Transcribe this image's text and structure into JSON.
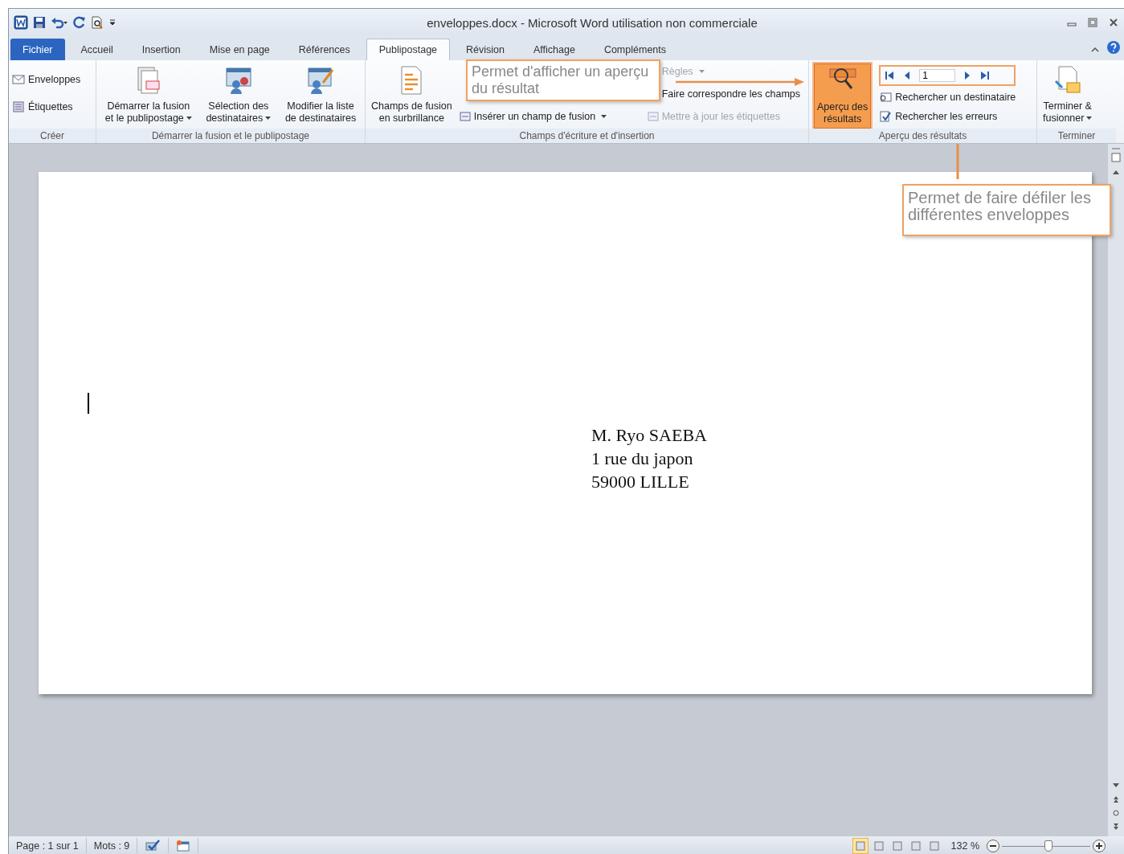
{
  "window": {
    "title": "enveloppes.docx - Microsoft Word utilisation non commerciale"
  },
  "tabs": [
    {
      "label": "Fichier",
      "kind": "file",
      "selected": false
    },
    {
      "label": "Accueil",
      "kind": "tab",
      "selected": false
    },
    {
      "label": "Insertion",
      "kind": "tab",
      "selected": false
    },
    {
      "label": "Mise en page",
      "kind": "tab",
      "selected": false
    },
    {
      "label": "Références",
      "kind": "tab",
      "selected": false
    },
    {
      "label": "Publipostage",
      "kind": "tab",
      "selected": true
    },
    {
      "label": "Révision",
      "kind": "tab",
      "selected": false
    },
    {
      "label": "Affichage",
      "kind": "tab",
      "selected": false
    },
    {
      "label": "Compléments",
      "kind": "tab",
      "selected": false
    }
  ],
  "ribbon": {
    "groups": [
      {
        "label": "Créer",
        "items": [
          {
            "kind": "small",
            "label": "Enveloppes",
            "disabled": false
          },
          {
            "kind": "small",
            "label": "Étiquettes",
            "disabled": false
          }
        ]
      },
      {
        "label": "Démarrer la fusion et le publipostage",
        "items": [
          {
            "kind": "large",
            "lines": [
              "Démarrer la fusion",
              "et le publipostage"
            ],
            "dropdown": true,
            "selected": false
          },
          {
            "kind": "large",
            "lines": [
              "Sélection des",
              "destinataires"
            ],
            "dropdown": true,
            "selected": false
          },
          {
            "kind": "large",
            "lines": [
              "Modifier la liste",
              "de destinataires"
            ],
            "selected": false
          }
        ]
      },
      {
        "label": "Champs d'écriture et d'insertion",
        "items": [
          {
            "kind": "large",
            "lines": [
              "Champs de fusion",
              "en surbrillance"
            ],
            "selected": false
          },
          {
            "kind": "column",
            "items": [
              {
                "label": "Insérer un champ de fusion",
                "dropdown": true,
                "disabled": false
              }
            ]
          },
          {
            "kind": "column",
            "items": [
              {
                "label": "Règles",
                "dropdown": true,
                "disabled": true
              },
              {
                "label": "Faire correspondre les champs",
                "disabled": false
              },
              {
                "label": "Mettre à jour les étiquettes",
                "disabled": true
              }
            ]
          }
        ]
      },
      {
        "label": "Aperçu des résultats",
        "items": [
          {
            "kind": "large",
            "lines": [
              "Aperçu des",
              "résultats"
            ],
            "selected": true
          },
          {
            "kind": "nav",
            "record": "1",
            "items": [
              {
                "label": "Rechercher un destinataire",
                "disabled": false
              },
              {
                "label": "Rechercher les erreurs",
                "disabled": false
              }
            ]
          }
        ]
      },
      {
        "label": "Terminer",
        "items": [
          {
            "kind": "large",
            "lines": [
              "Terminer &",
              "fusionner"
            ],
            "dropdown": true,
            "selected": false
          }
        ]
      }
    ]
  },
  "callouts": [
    {
      "text": "Permet d'afficher un aperçu du résultat"
    },
    {
      "text": "Permet de faire défiler les différentes enveloppes"
    }
  ],
  "document": {
    "address": [
      "M. Ryo SAEBA",
      "1 rue du japon",
      "59000 LILLE"
    ]
  },
  "status_bar": {
    "page": "Page : 1 sur 1",
    "words": "Mots : 9",
    "views": [
      {
        "selected": true
      },
      {
        "selected": false
      },
      {
        "selected": false
      },
      {
        "selected": false
      },
      {
        "selected": false
      }
    ],
    "zoom": "132 %",
    "zoom_slider": {
      "level": 0.53
    }
  }
}
